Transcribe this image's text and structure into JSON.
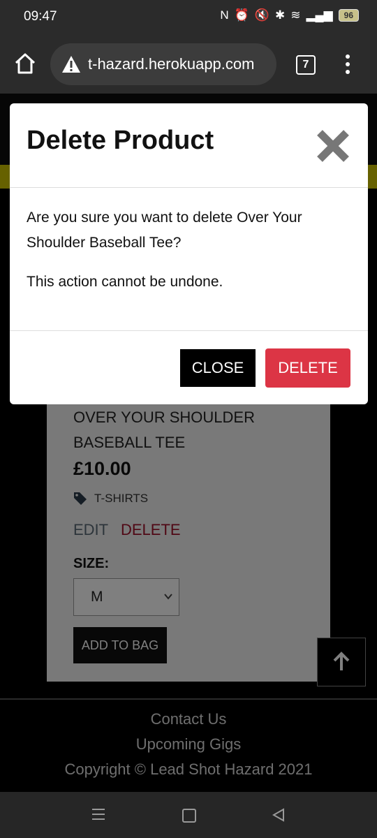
{
  "status": {
    "time": "09:47",
    "battery": "96"
  },
  "browser": {
    "url": "t-hazard.herokuapp.com",
    "tab_count": "7"
  },
  "product": {
    "name": "OVER YOUR SHOULDER BASEBALL TEE",
    "price": "£10.00",
    "category": "T-SHIRTS",
    "edit_label": "EDIT",
    "delete_label": "DELETE",
    "size_label": "SIZE:",
    "size_value": "M",
    "add_to_bag": "ADD TO BAG"
  },
  "footer": {
    "links": [
      "Contact Us",
      "Upcoming Gigs"
    ],
    "copyright": "Copyright © Lead Shot Hazard 2021"
  },
  "modal": {
    "title": "Delete Product",
    "message": "Are you sure you want to delete Over Your Shoulder Baseball Tee?",
    "warning": "This action cannot be undone.",
    "close_label": "CLOSE",
    "delete_label": "DELETE"
  },
  "colors": {
    "danger": "#dc3545",
    "accent_stripe": "#ccc200"
  }
}
